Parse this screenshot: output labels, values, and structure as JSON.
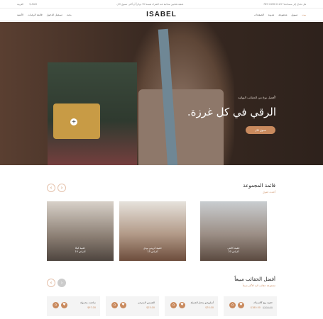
{
  "topbar": {
    "left_lang": "العربية",
    "left_currency": "$ AUD",
    "promo": "ضعية هنانيبن مجانية عند الشراء بقيمة 90 دولاراً أو أكثر. تسوق الآن",
    "right_contact": "هل تحتاج إلى مساعدة؟ 0123 0456 789"
  },
  "header": {
    "logo": "ISABEL",
    "left_items": [
      "الأمنية",
      "قائمة الرغبات",
      "تسجيل الدخول",
      "بحث"
    ],
    "right_items": [
      "بيت",
      "تسوق",
      "مجموعة",
      "مدونة",
      "الصفحات"
    ],
    "accent": "#c98a5e"
  },
  "hero": {
    "eyebrow": "أفضل نوع من الحقائب النهائية!",
    "headline": "الرقي في كل غرزة.",
    "cta": "تسوق الآن",
    "plus": "+"
  },
  "collection": {
    "title": "قائمة المجموعة",
    "subtitle": "أحدث جدول",
    "prev": "‹",
    "next": "›",
    "cards": [
      {
        "name": "حقيبة كيكا",
        "count": "19 أغراض"
      },
      {
        "name": "حقيبة كروس بودي",
        "count": "15 أغراض"
      },
      {
        "name": "حقيبة كالنتي",
        "count": "20 أغراض"
      }
    ]
  },
  "bestsellers": {
    "title": "أفضل الحقائب مبيعاً",
    "subtitle": "مجموعة حقائب اليد الأكثر مبيعاً",
    "prev": "‹",
    "next": "›",
    "products": [
      {
        "title": "ساجنت محمولة",
        "price": "$97.00",
        "old": ""
      },
      {
        "title": "الشمس المترجم",
        "price": "$25.00",
        "old": ""
      },
      {
        "title": "أسليوجيو مختار الجميلة",
        "price": "$70.00",
        "old": ""
      },
      {
        "title": "حقيبة زيج كالسماك",
        "price": "$180.00",
        "old": "$200.00"
      }
    ]
  }
}
